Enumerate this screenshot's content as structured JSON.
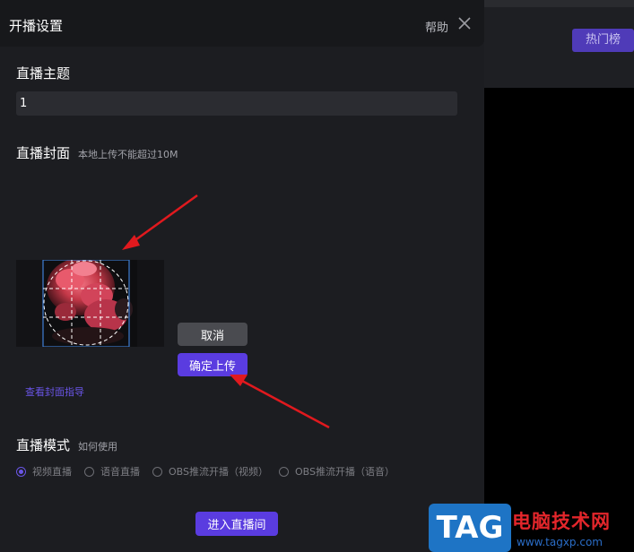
{
  "dialog": {
    "title": "开播设置",
    "help_label": "帮助",
    "icons": {
      "close": "close-icon"
    }
  },
  "topic": {
    "label": "直播主题",
    "value": "1"
  },
  "cover": {
    "label": "直播封面",
    "hint": "本地上传不能超过10M",
    "cancel_label": "取消",
    "confirm_label": "确定上传",
    "guide_link": "查看封面指导"
  },
  "mode": {
    "label": "直播模式",
    "help_link": "如何使用",
    "options": [
      {
        "label": "视频直播",
        "selected": true
      },
      {
        "label": "语音直播",
        "selected": false
      },
      {
        "label": "OBS推流开播（视频）",
        "selected": false
      },
      {
        "label": "OBS推流开播（语音）",
        "selected": false
      }
    ]
  },
  "enter_label": "进入直播间",
  "background": {
    "hot_button": "热门榜"
  },
  "watermark": {
    "tag": "TAG",
    "site_name": "电脑技术网",
    "url": "www.tagxp.com"
  },
  "colors": {
    "accent": "#5a3ce0",
    "link": "#6a55e6",
    "arrow": "#e0191e",
    "panel": "#1c1d21"
  }
}
